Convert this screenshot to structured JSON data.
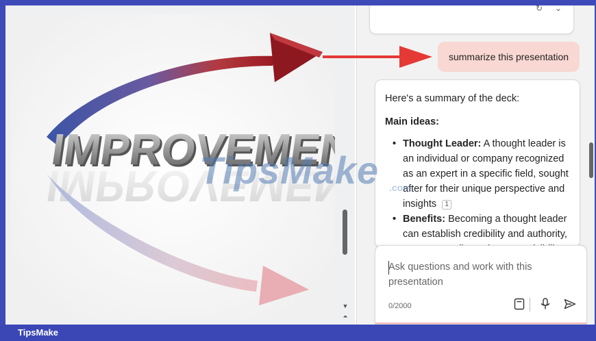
{
  "slide": {
    "word": "IMPROVEMENT",
    "colors": {
      "arrow_blue": "#3a55a6",
      "arrow_red": "#9a1a22"
    }
  },
  "chat": {
    "user_message": "summarize this presentation",
    "reply": {
      "intro": "Here's a summary of the deck:",
      "heading": "Main ideas:",
      "bullets": [
        {
          "term": "Thought Leader:",
          "text": "A thought leader is an individual or company recognized as an expert in a specific field, sought after for their unique perspective and insights",
          "citation": "1"
        },
        {
          "term": "Benefits:",
          "text": "Becoming a thought leader can establish credibility and authority, attract new clients, increase visibility"
        }
      ]
    },
    "composer": {
      "placeholder": "Ask questions and work with this presentation",
      "char_count": "0/2000",
      "icons": [
        "notebook-icon",
        "microphone-icon",
        "send-icon"
      ]
    }
  },
  "watermark": {
    "text": "TipsMake",
    "suffix": ".com"
  },
  "footer": {
    "brand": "TipsMake"
  },
  "colors": {
    "accent": "#3a47b5",
    "user_bubble": "#f9d7d2",
    "annotation_arrow": "#e53935"
  }
}
